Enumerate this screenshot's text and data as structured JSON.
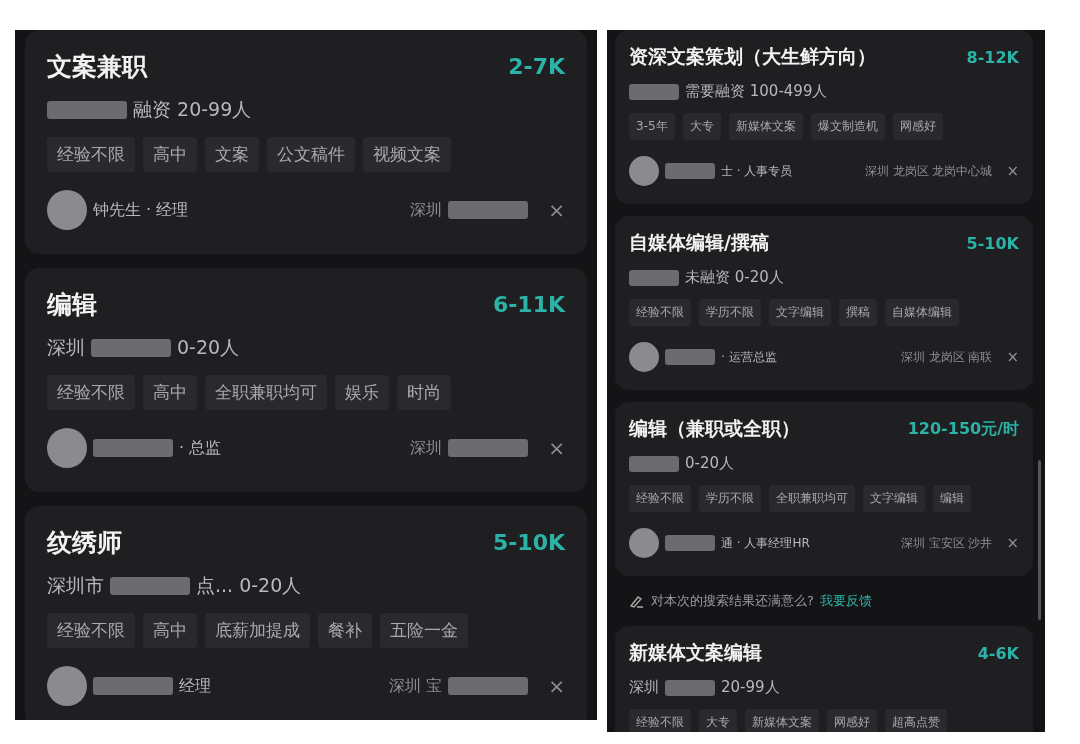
{
  "panels": [
    {
      "kind": "large",
      "items": [
        {
          "kind": "job",
          "title": "文案兼职",
          "salary": "2-7K",
          "company": [
            {
              "kind": "redacted"
            },
            {
              "kind": "text",
              "text": "融资 20-99人"
            }
          ],
          "tags": [
            "经验不限",
            "高中",
            "文案",
            "公文稿件",
            "视频文案"
          ],
          "recruiter": [
            {
              "kind": "text",
              "text": "钟先生 · 经理"
            }
          ],
          "location": [
            {
              "kind": "text",
              "text": "深圳"
            },
            {
              "kind": "redacted"
            }
          ],
          "dismiss": "×"
        },
        {
          "kind": "job",
          "title": "编辑",
          "salary": "6-11K",
          "company": [
            {
              "kind": "text",
              "text": "深圳"
            },
            {
              "kind": "redacted"
            },
            {
              "kind": "text",
              "text": "0-20人"
            }
          ],
          "tags": [
            "经验不限",
            "高中",
            "全职兼职均可",
            "娱乐",
            "时尚"
          ],
          "recruiter": [
            {
              "kind": "redacted"
            },
            {
              "kind": "text",
              "text": "· 总监"
            }
          ],
          "location": [
            {
              "kind": "text",
              "text": "深圳"
            },
            {
              "kind": "redacted"
            }
          ],
          "dismiss": "×"
        },
        {
          "kind": "job",
          "title": "纹绣师",
          "salary": "5-10K",
          "company": [
            {
              "kind": "text",
              "text": "深圳市"
            },
            {
              "kind": "redacted"
            },
            {
              "kind": "text",
              "text": "点... 0-20人"
            }
          ],
          "tags": [
            "经验不限",
            "高中",
            "底薪加提成",
            "餐补",
            "五险一金"
          ],
          "recruiter": [
            {
              "kind": "redacted"
            },
            {
              "kind": "text",
              "text": "经理"
            }
          ],
          "location": [
            {
              "kind": "text",
              "text": "深圳 宝"
            },
            {
              "kind": "redacted"
            }
          ],
          "dismiss": "×"
        }
      ]
    },
    {
      "kind": "small",
      "items": [
        {
          "kind": "job",
          "title": "资深文案策划（大生鲜方向）",
          "salary": "8-12K",
          "company": [
            {
              "kind": "redacted"
            },
            {
              "kind": "text",
              "text": "需要融资 100-499人"
            }
          ],
          "tags": [
            "3-5年",
            "大专",
            "新媒体文案",
            "爆文制造机",
            "网感好"
          ],
          "recruiter": [
            {
              "kind": "redacted"
            },
            {
              "kind": "text",
              "text": "士 · 人事专员"
            }
          ],
          "location": [
            {
              "kind": "text",
              "text": "深圳 龙岗区 龙岗中心城"
            }
          ],
          "dismiss": "×"
        },
        {
          "kind": "job",
          "title": "自媒体编辑/撰稿",
          "salary": "5-10K",
          "company": [
            {
              "kind": "redacted"
            },
            {
              "kind": "text",
              "text": "未融资 0-20人"
            }
          ],
          "tags": [
            "经验不限",
            "学历不限",
            "文字编辑",
            "撰稿",
            "自媒体编辑"
          ],
          "recruiter": [
            {
              "kind": "redacted"
            },
            {
              "kind": "text",
              "text": "· 运营总监"
            }
          ],
          "location": [
            {
              "kind": "text",
              "text": "深圳 龙岗区 南联"
            }
          ],
          "dismiss": "×"
        },
        {
          "kind": "job",
          "title": "编辑（兼职或全职）",
          "salary": "120-150元/时",
          "company": [
            {
              "kind": "redacted"
            },
            {
              "kind": "text",
              "text": "0-20人"
            }
          ],
          "tags": [
            "经验不限",
            "学历不限",
            "全职兼职均可",
            "文字编辑",
            "编辑"
          ],
          "recruiter": [
            {
              "kind": "redacted"
            },
            {
              "kind": "text",
              "text": "通 · 人事经理HR"
            }
          ],
          "location": [
            {
              "kind": "text",
              "text": "深圳 宝安区 沙井"
            }
          ],
          "dismiss": "×"
        },
        {
          "kind": "feedback",
          "text": "对本次的搜索结果还满意么?",
          "link": "我要反馈"
        },
        {
          "kind": "job",
          "title": "新媒体文案编辑",
          "salary": "4-6K",
          "company": [
            {
              "kind": "text",
              "text": "深圳"
            },
            {
              "kind": "redacted"
            },
            {
              "kind": "text",
              "text": "20-99人"
            }
          ],
          "tags": [
            "经验不限",
            "大专",
            "新媒体文案",
            "网感好",
            "超高点赞"
          ]
        }
      ]
    }
  ]
}
